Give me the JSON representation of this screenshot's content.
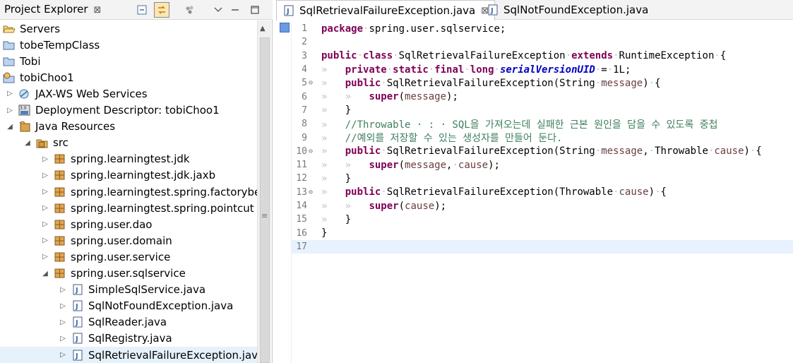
{
  "explorer": {
    "title": "Project Explorer",
    "close_glyph": "⊠",
    "tree": [
      {
        "label": "Servers",
        "icon": "folder-open-icon",
        "toggle": "",
        "depth": 0
      },
      {
        "label": "tobeTempClass",
        "icon": "project-icon",
        "toggle": "",
        "depth": 0
      },
      {
        "label": "Tobi",
        "icon": "project-icon",
        "toggle": "",
        "depth": 0
      },
      {
        "label": "tobiChoo1",
        "icon": "web-project-icon",
        "toggle": "",
        "depth": 0
      },
      {
        "label": "JAX-WS Web Services",
        "icon": "jaxws-icon",
        "toggle": "▷",
        "depth": 1
      },
      {
        "label": "Deployment Descriptor: tobiChoo1",
        "icon": "descriptor-icon",
        "toggle": "▷",
        "depth": 1
      },
      {
        "label": "Java Resources",
        "icon": "java-resources-icon",
        "toggle": "◢",
        "depth": 1
      },
      {
        "label": "src",
        "icon": "source-folder-icon",
        "toggle": "◢",
        "depth": 2
      },
      {
        "label": "spring.learningtest.jdk",
        "icon": "package-icon",
        "toggle": "▷",
        "depth": 3
      },
      {
        "label": "spring.learningtest.jdk.jaxb",
        "icon": "package-icon",
        "toggle": "▷",
        "depth": 3
      },
      {
        "label": "spring.learningtest.spring.factorybean",
        "icon": "package-icon",
        "toggle": "▷",
        "depth": 3
      },
      {
        "label": "spring.learningtest.spring.pointcut",
        "icon": "package-icon",
        "toggle": "▷",
        "depth": 3
      },
      {
        "label": "spring.user.dao",
        "icon": "package-icon",
        "toggle": "▷",
        "depth": 3
      },
      {
        "label": "spring.user.domain",
        "icon": "package-icon",
        "toggle": "▷",
        "depth": 3
      },
      {
        "label": "spring.user.service",
        "icon": "package-icon",
        "toggle": "▷",
        "depth": 3
      },
      {
        "label": "spring.user.sqlservice",
        "icon": "package-icon",
        "toggle": "◢",
        "depth": 3
      },
      {
        "label": "SimpleSqlService.java",
        "icon": "java-file-icon",
        "toggle": "▷",
        "depth": 4
      },
      {
        "label": "SqlNotFoundException.java",
        "icon": "java-file-icon",
        "toggle": "▷",
        "depth": 4
      },
      {
        "label": "SqlReader.java",
        "icon": "java-file-icon",
        "toggle": "▷",
        "depth": 4
      },
      {
        "label": "SqlRegistry.java",
        "icon": "java-file-icon",
        "toggle": "▷",
        "depth": 4
      },
      {
        "label": "SqlRetrievalFailureException.java",
        "icon": "java-file-icon",
        "toggle": "▷",
        "depth": 4,
        "selected": true
      }
    ]
  },
  "editor": {
    "tabs": [
      {
        "label": "SqlRetrievalFailureException.java",
        "active": true,
        "close_glyph": "⊠"
      },
      {
        "label": "SqlNotFoundException.java",
        "active": false
      }
    ],
    "lines": [
      {
        "n": "1",
        "fold": "",
        "segs": [
          [
            "kw",
            "package"
          ],
          [
            "ws",
            "·"
          ],
          [
            "p",
            "spring.user.sqlservice;"
          ]
        ]
      },
      {
        "n": "2",
        "fold": "",
        "segs": []
      },
      {
        "n": "3",
        "fold": "",
        "segs": [
          [
            "kw",
            "public"
          ],
          [
            "ws",
            "·"
          ],
          [
            "kw",
            "class"
          ],
          [
            "ws",
            "·"
          ],
          [
            "p",
            "SqlRetrievalFailureException"
          ],
          [
            "ws",
            "·"
          ],
          [
            "kw",
            "extends"
          ],
          [
            "ws",
            "·"
          ],
          [
            "p",
            "RuntimeException"
          ],
          [
            "ws",
            "·"
          ],
          [
            "p",
            "{"
          ]
        ]
      },
      {
        "n": "4",
        "fold": "",
        "segs": [
          [
            "ws",
            "»   "
          ],
          [
            "kw",
            "private"
          ],
          [
            "ws",
            "·"
          ],
          [
            "kw",
            "static"
          ],
          [
            "ws",
            "·"
          ],
          [
            "kw",
            "final"
          ],
          [
            "ws",
            "·"
          ],
          [
            "kw",
            "long"
          ],
          [
            "ws",
            "·"
          ],
          [
            "fld",
            "serialVersionUID"
          ],
          [
            "ws",
            "·"
          ],
          [
            "p",
            "="
          ],
          [
            "ws",
            "·"
          ],
          [
            "p",
            "1L;"
          ]
        ]
      },
      {
        "n": "5",
        "fold": "⊖",
        "segs": [
          [
            "ws",
            "»   "
          ],
          [
            "kw",
            "public"
          ],
          [
            "ws",
            "·"
          ],
          [
            "p",
            "SqlRetrievalFailureException(String"
          ],
          [
            "ws",
            "·"
          ],
          [
            "prm",
            "message"
          ],
          [
            "p",
            ")"
          ],
          [
            "ws",
            "·"
          ],
          [
            "p",
            "{"
          ]
        ]
      },
      {
        "n": "6",
        "fold": "",
        "segs": [
          [
            "ws",
            "»   »   "
          ],
          [
            "kw",
            "super"
          ],
          [
            "p",
            "("
          ],
          [
            "prm",
            "message"
          ],
          [
            "p",
            ");"
          ]
        ]
      },
      {
        "n": "7",
        "fold": "",
        "segs": [
          [
            "ws",
            "»   "
          ],
          [
            "p",
            "}"
          ]
        ]
      },
      {
        "n": "8",
        "fold": "",
        "segs": [
          [
            "ws",
            "»   "
          ],
          [
            "cm",
            "//Throwable · : · SQL을 가져오는데 실패한 근본 원인을 담을 수 있도록 중첩"
          ]
        ]
      },
      {
        "n": "9",
        "fold": "",
        "segs": [
          [
            "ws",
            "»   "
          ],
          [
            "cm",
            "//예외를 저장할 수 있는 생성자를 만들어 둔다."
          ]
        ]
      },
      {
        "n": "10",
        "fold": "⊖",
        "segs": [
          [
            "ws",
            "»   "
          ],
          [
            "kw",
            "public"
          ],
          [
            "ws",
            "·"
          ],
          [
            "p",
            "SqlRetrievalFailureException(String"
          ],
          [
            "ws",
            "·"
          ],
          [
            "prm",
            "message"
          ],
          [
            "p",
            ","
          ],
          [
            "ws",
            "·"
          ],
          [
            "p",
            "Throwable"
          ],
          [
            "ws",
            "·"
          ],
          [
            "prm",
            "cause"
          ],
          [
            "p",
            ")"
          ],
          [
            "ws",
            "·"
          ],
          [
            "p",
            "{"
          ]
        ]
      },
      {
        "n": "11",
        "fold": "",
        "segs": [
          [
            "ws",
            "»   »   "
          ],
          [
            "kw",
            "super"
          ],
          [
            "p",
            "("
          ],
          [
            "prm",
            "message"
          ],
          [
            "p",
            ","
          ],
          [
            "ws",
            "·"
          ],
          [
            "prm",
            "cause"
          ],
          [
            "p",
            ");"
          ]
        ]
      },
      {
        "n": "12",
        "fold": "",
        "segs": [
          [
            "ws",
            "»   "
          ],
          [
            "p",
            "}"
          ]
        ]
      },
      {
        "n": "13",
        "fold": "⊖",
        "segs": [
          [
            "ws",
            "»   "
          ],
          [
            "kw",
            "public"
          ],
          [
            "ws",
            "·"
          ],
          [
            "p",
            "SqlRetrievalFailureException(Throwable"
          ],
          [
            "ws",
            "·"
          ],
          [
            "prm",
            "cause"
          ],
          [
            "p",
            ")"
          ],
          [
            "ws",
            "·"
          ],
          [
            "p",
            "{"
          ]
        ]
      },
      {
        "n": "14",
        "fold": "",
        "segs": [
          [
            "ws",
            "»   »   "
          ],
          [
            "kw",
            "super"
          ],
          [
            "p",
            "("
          ],
          [
            "prm",
            "cause"
          ],
          [
            "p",
            ");"
          ]
        ]
      },
      {
        "n": "15",
        "fold": "",
        "segs": [
          [
            "ws",
            "»   "
          ],
          [
            "p",
            "}"
          ]
        ]
      },
      {
        "n": "16",
        "fold": "",
        "segs": [
          [
            "p",
            "}"
          ]
        ]
      },
      {
        "n": "17",
        "fold": "",
        "segs": [],
        "current": true
      }
    ]
  },
  "colors": {
    "keyword": "#7f0055",
    "field": "#0000c0",
    "parameter": "#6a3e3e",
    "comment": "#3f7f5f",
    "current_line": "#e8f2fe"
  }
}
